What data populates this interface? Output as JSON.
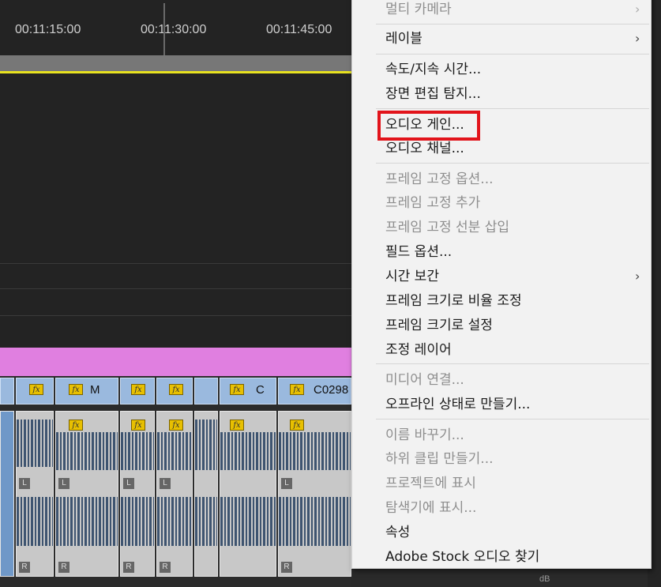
{
  "timeline": {
    "timecodes": [
      "00:11:15:00",
      "00:11:30:00",
      "00:11:45:00"
    ],
    "clip_labels": [
      "M",
      "C",
      "C0298"
    ],
    "audio_channels": [
      "L",
      "R"
    ],
    "meter_unit": "dB",
    "colors": {
      "workarea": "#e8e21f",
      "adjustment_track": "#e07fe0",
      "video_clip": "#9ab9de",
      "audio_waveform": "#3e5470"
    }
  },
  "context_menu": {
    "items": [
      {
        "label": "멀티 카메라",
        "enabled": false,
        "submenu": true
      },
      {
        "label": "레이블",
        "enabled": true,
        "submenu": true
      },
      {
        "label": "속도/지속 시간...",
        "enabled": true,
        "submenu": false
      },
      {
        "label": "장면 편집 탐지...",
        "enabled": true,
        "submenu": false
      },
      {
        "label": "오디오 게인...",
        "enabled": true,
        "submenu": false,
        "highlighted": true
      },
      {
        "label": "오디오 채널...",
        "enabled": true,
        "submenu": false
      },
      {
        "label": "프레임 고정 옵션...",
        "enabled": false,
        "submenu": false
      },
      {
        "label": "프레임 고정 추가",
        "enabled": false,
        "submenu": false
      },
      {
        "label": "프레임 고정 선분 삽입",
        "enabled": false,
        "submenu": false
      },
      {
        "label": "필드 옵션...",
        "enabled": true,
        "submenu": false
      },
      {
        "label": "시간 보간",
        "enabled": true,
        "submenu": true
      },
      {
        "label": "프레임 크기로 비율 조정",
        "enabled": true,
        "submenu": false
      },
      {
        "label": "프레임 크기로 설정",
        "enabled": true,
        "submenu": false
      },
      {
        "label": "조정 레이어",
        "enabled": true,
        "submenu": false
      },
      {
        "label": "미디어 연결...",
        "enabled": false,
        "submenu": false
      },
      {
        "label": "오프라인 상태로 만들기...",
        "enabled": true,
        "submenu": false
      },
      {
        "label": "이름 바꾸기...",
        "enabled": false,
        "submenu": false
      },
      {
        "label": "하위 클립 만들기...",
        "enabled": false,
        "submenu": false
      },
      {
        "label": "프로젝트에 표시",
        "enabled": false,
        "submenu": false
      },
      {
        "label": "탐색기에 표시...",
        "enabled": false,
        "submenu": false
      },
      {
        "label": "속성",
        "enabled": true,
        "submenu": false
      },
      {
        "label": "Adobe Stock 오디오 찾기",
        "enabled": true,
        "submenu": false
      }
    ],
    "highlight_color": "#e2141b"
  }
}
